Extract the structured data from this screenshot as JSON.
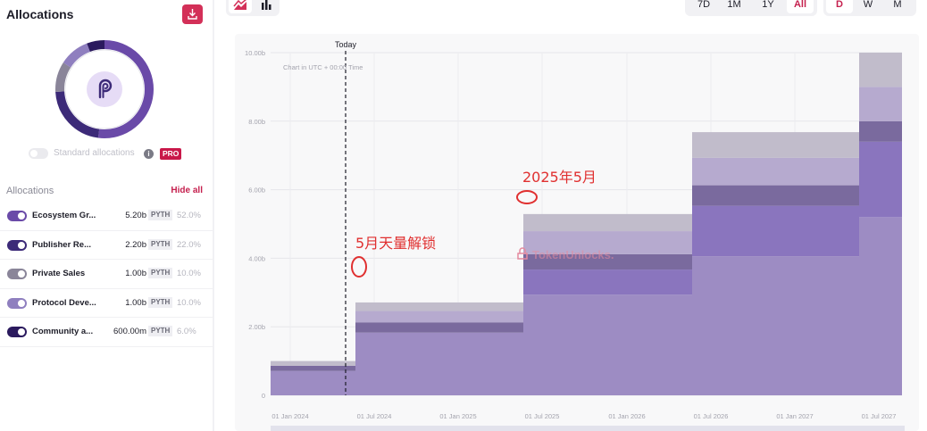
{
  "left_panel": {
    "title": "Allocations",
    "download_icon": "download-icon",
    "standard_label": "Standard allocations",
    "pro_badge": "PRO",
    "header_label": "Allocations",
    "hide_all_label": "Hide all",
    "rows": [
      {
        "name": "Ecosystem Gr...",
        "amount": "5.20b",
        "token": "PYTH",
        "pct": "52.0%",
        "color": "#6a4aa8"
      },
      {
        "name": "Publisher Re...",
        "amount": "2.20b",
        "token": "PYTH",
        "pct": "22.0%",
        "color": "#3c2a78"
      },
      {
        "name": "Private Sales",
        "amount": "1.00b",
        "token": "PYTH",
        "pct": "10.0%",
        "color": "#8a8599"
      },
      {
        "name": "Protocol Deve...",
        "amount": "1.00b",
        "token": "PYTH",
        "pct": "10.0%",
        "color": "#8f7fbf"
      },
      {
        "name": "Community a...",
        "amount": "600.00m",
        "token": "PYTH",
        "pct": "6.0%",
        "color": "#2b1a5e"
      }
    ]
  },
  "toolbar": {
    "ranges": [
      "7D",
      "1M",
      "1Y",
      "All"
    ],
    "range_selected": "All",
    "granularity": [
      "D",
      "W",
      "M"
    ],
    "granularity_selected": "D"
  },
  "chart_note": "Chart in UTC + 00:00 Time",
  "today_label": "Today",
  "watermark": "TokenUnlocks.",
  "annotations": {
    "first": "5月天量解锁",
    "second": "2025年5月"
  },
  "chart_data": {
    "type": "area",
    "stepped": true,
    "stacked": true,
    "x_tick_labels": [
      "01 Jan 2024",
      "01 Jul 2024",
      "01 Jan 2025",
      "01 Jul 2025",
      "01 Jan 2026",
      "01 Jul 2026",
      "01 Jan 2027",
      "01 Jul 2027"
    ],
    "y_tick_labels": [
      "0",
      "2.00b",
      "4.00b",
      "6.00b",
      "8.00b",
      "10.00b"
    ],
    "ylim": [
      0,
      10.0
    ],
    "y_unit": "b",
    "steps": [
      "Nov 2023",
      "May 2024",
      "May 2025",
      "May 2026",
      "May 2027"
    ],
    "series": [
      {
        "name": "Ecosystem Gr...",
        "color": "#9d8cc3",
        "values": [
          0.71,
          1.83,
          2.94,
          4.06,
          5.2
        ]
      },
      {
        "name": "Publisher Re...",
        "color": "#8a75be",
        "values": [
          0.0,
          0.0,
          0.73,
          1.47,
          2.2
        ]
      },
      {
        "name": "Community a...",
        "color": "#7a6a9e",
        "values": [
          0.15,
          0.3,
          0.45,
          0.6,
          0.6
        ]
      },
      {
        "name": "Protocol Deve...",
        "color": "#b6aacf",
        "values": [
          0.0,
          0.33,
          0.67,
          0.8,
          1.0
        ]
      },
      {
        "name": "Private Sales",
        "color": "#c1bccb",
        "values": [
          0.14,
          0.25,
          0.5,
          0.75,
          1.0
        ]
      }
    ],
    "grid": true
  }
}
